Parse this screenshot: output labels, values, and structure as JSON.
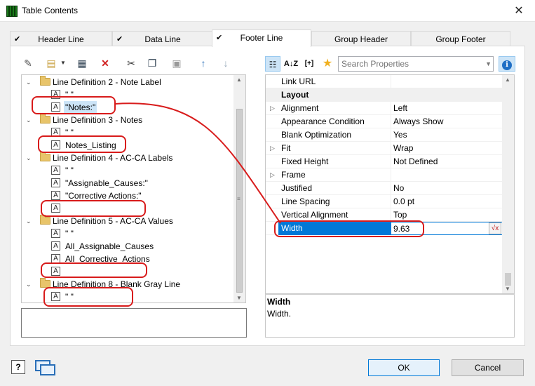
{
  "window": {
    "title": "Table Contents",
    "close_glyph": "✕"
  },
  "tabs": [
    {
      "label": "Header Line",
      "checked": true
    },
    {
      "label": "Data Line",
      "checked": true
    },
    {
      "label": "Footer Line",
      "checked": true
    },
    {
      "label": "Group Header",
      "checked": false
    },
    {
      "label": "Group Footer",
      "checked": false
    }
  ],
  "toolbar_left": {
    "icons": [
      "magic-wand-icon",
      "new-item-icon",
      "properties-icon",
      "delete-icon",
      "cut-icon",
      "copy-icon",
      "paste-icon",
      "move-up-icon",
      "move-down-icon"
    ]
  },
  "tree": {
    "rows": [
      {
        "type": "folder",
        "label": "Line Definition 2 - Note Label"
      },
      {
        "type": "field",
        "label": "\" \""
      },
      {
        "type": "field",
        "label": "\"Notes:\"",
        "selected": true
      },
      {
        "type": "folder",
        "label": "Line Definition 3 - Notes"
      },
      {
        "type": "field",
        "label": "\" \""
      },
      {
        "type": "field",
        "label": "Notes_Listing"
      },
      {
        "type": "folder",
        "label": "Line Definition 4 - AC-CA Labels"
      },
      {
        "type": "field",
        "label": "\" \""
      },
      {
        "type": "field",
        "label": "\"Assignable_Causes:\""
      },
      {
        "type": "field",
        "label": "\"Corrective Actions:\""
      },
      {
        "type": "field",
        "label": ""
      },
      {
        "type": "folder",
        "label": "Line Definition 5 - AC-CA Values"
      },
      {
        "type": "field",
        "label": "\" \""
      },
      {
        "type": "field",
        "label": "All_Assignable_Causes"
      },
      {
        "type": "field",
        "label": "All_Corrective_Actions"
      },
      {
        "type": "field",
        "label": ""
      },
      {
        "type": "folder",
        "label": "Line Definition  8 - Blank Gray Line"
      },
      {
        "type": "field",
        "label": "\" \""
      }
    ]
  },
  "properties_toolbar": {
    "search_placeholder": "Search Properties",
    "sort_label": "A↓Z",
    "expand_label": "[+]"
  },
  "properties": [
    {
      "name": "Link URL",
      "value": "",
      "kind": "prop"
    },
    {
      "name": "Layout",
      "value": "",
      "kind": "category"
    },
    {
      "name": "Alignment",
      "value": "Left",
      "kind": "expandable"
    },
    {
      "name": "Appearance Condition",
      "value": "Always Show",
      "kind": "prop"
    },
    {
      "name": "Blank Optimization",
      "value": "Yes",
      "kind": "prop"
    },
    {
      "name": "Fit",
      "value": "Wrap",
      "kind": "expandable"
    },
    {
      "name": "Fixed Height",
      "value": "Not Defined",
      "kind": "prop"
    },
    {
      "name": "Frame",
      "value": "",
      "kind": "expandable"
    },
    {
      "name": "Justified",
      "value": "No",
      "kind": "prop"
    },
    {
      "name": "Line Spacing",
      "value": "0.0 pt",
      "kind": "prop"
    },
    {
      "name": "Vertical Alignment",
      "value": "Top",
      "kind": "prop"
    },
    {
      "name": "Width",
      "value": "9.63",
      "kind": "selected"
    }
  ],
  "help": {
    "heading": "Width",
    "text": "Width."
  },
  "buttons": {
    "ok": "OK",
    "cancel": "Cancel"
  },
  "formula_button_label": "√x",
  "colors": {
    "accent": "#0078d7",
    "annotation": "#d81b1b",
    "selection": "#cce4f7"
  }
}
